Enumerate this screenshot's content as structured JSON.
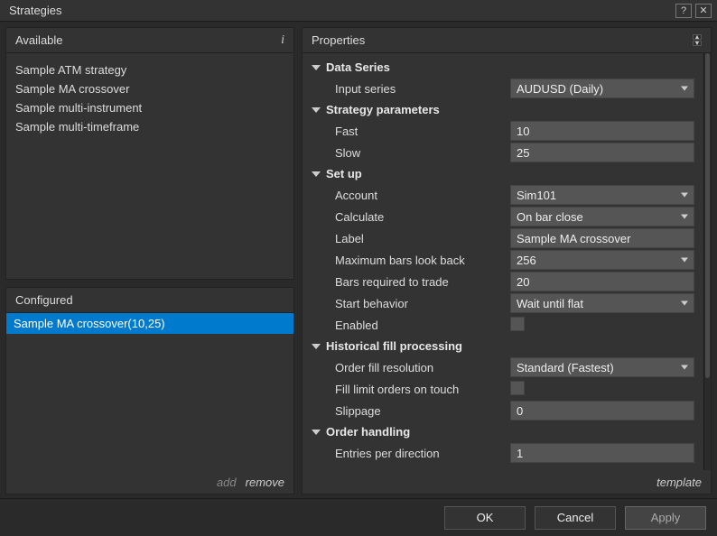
{
  "window": {
    "title": "Strategies"
  },
  "available": {
    "title": "Available",
    "items": [
      "Sample ATM strategy",
      "Sample MA crossover",
      "Sample multi-instrument",
      "Sample multi-timeframe"
    ]
  },
  "configured": {
    "title": "Configured",
    "items": [
      "Sample MA crossover(10,25)"
    ],
    "selected_index": 0,
    "add_label": "add",
    "remove_label": "remove"
  },
  "properties": {
    "title": "Properties",
    "template_label": "template",
    "groups": {
      "data_series": {
        "label": "Data Series",
        "input_series": {
          "label": "Input series",
          "value": "AUDUSD (Daily)"
        }
      },
      "strategy_parameters": {
        "label": "Strategy parameters",
        "fast": {
          "label": "Fast",
          "value": "10"
        },
        "slow": {
          "label": "Slow",
          "value": "25"
        }
      },
      "setup": {
        "label": "Set up",
        "account": {
          "label": "Account",
          "value": "Sim101"
        },
        "calculate": {
          "label": "Calculate",
          "value": "On bar close"
        },
        "label_field": {
          "label": "Label",
          "value": "Sample MA crossover"
        },
        "max_bars": {
          "label": "Maximum bars look back",
          "value": "256"
        },
        "bars_required": {
          "label": "Bars required to trade",
          "value": "20"
        },
        "start_behavior": {
          "label": "Start behavior",
          "value": "Wait until flat"
        },
        "enabled": {
          "label": "Enabled",
          "value": false
        }
      },
      "historical_fill": {
        "label": "Historical fill processing",
        "order_fill": {
          "label": "Order fill resolution",
          "value": "Standard (Fastest)"
        },
        "fill_limit": {
          "label": "Fill limit orders on touch",
          "value": false
        },
        "slippage": {
          "label": "Slippage",
          "value": "0"
        }
      },
      "order_handling": {
        "label": "Order handling",
        "entries_per_direction": {
          "label": "Entries per direction",
          "value": "1"
        }
      }
    }
  },
  "buttons": {
    "ok": "OK",
    "cancel": "Cancel",
    "apply": "Apply"
  }
}
